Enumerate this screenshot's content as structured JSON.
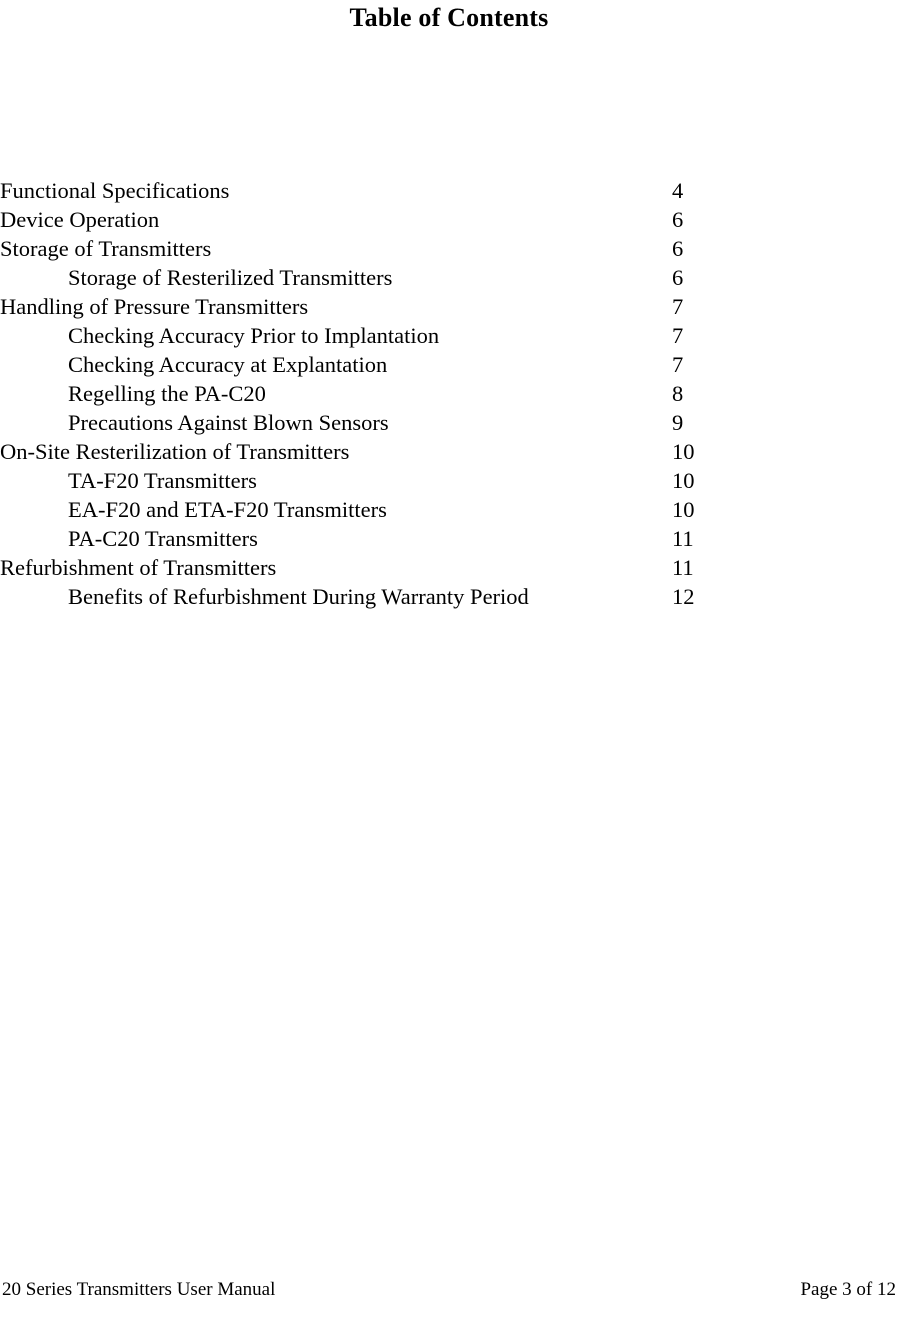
{
  "document": {
    "title": "Table of Contents",
    "toc": [
      {
        "title": "Functional Specifications",
        "page": "4",
        "level": 1
      },
      {
        "title": "Device Operation",
        "page": "6",
        "level": 1
      },
      {
        "title": "Storage of Transmitters",
        "page": "6",
        "level": 1
      },
      {
        "title": "Storage of Resterilized Transmitters",
        "page": "6",
        "level": 2
      },
      {
        "title": "Handling of Pressure Transmitters",
        "page": "7",
        "level": 1
      },
      {
        "title": "Checking Accuracy Prior to Implantation",
        "page": "7",
        "level": 2
      },
      {
        "title": "Checking Accuracy at Explantation",
        "page": "7",
        "level": 2
      },
      {
        "title": "Regelling the PA-C20",
        "page": "8",
        "level": 2
      },
      {
        "title": "Precautions Against Blown Sensors",
        "page": "9",
        "level": 2
      },
      {
        "title": "On-Site Resterilization of Transmitters",
        "page": "10",
        "level": 1
      },
      {
        "title": "TA-F20 Transmitters",
        "page": "10",
        "level": 2
      },
      {
        "title": "EA-F20 and ETA-F20 Transmitters",
        "page": "10",
        "level": 2
      },
      {
        "title": "PA-C20 Transmitters",
        "page": "11",
        "level": 2
      },
      {
        "title": "Refurbishment of Transmitters",
        "page": "11",
        "level": 1
      },
      {
        "title": "Benefits of Refurbishment During Warranty Period",
        "page": "12",
        "level": 2
      }
    ],
    "footer": {
      "left": "20 Series Transmitters User Manual",
      "right": "Page 3 of 12"
    }
  }
}
